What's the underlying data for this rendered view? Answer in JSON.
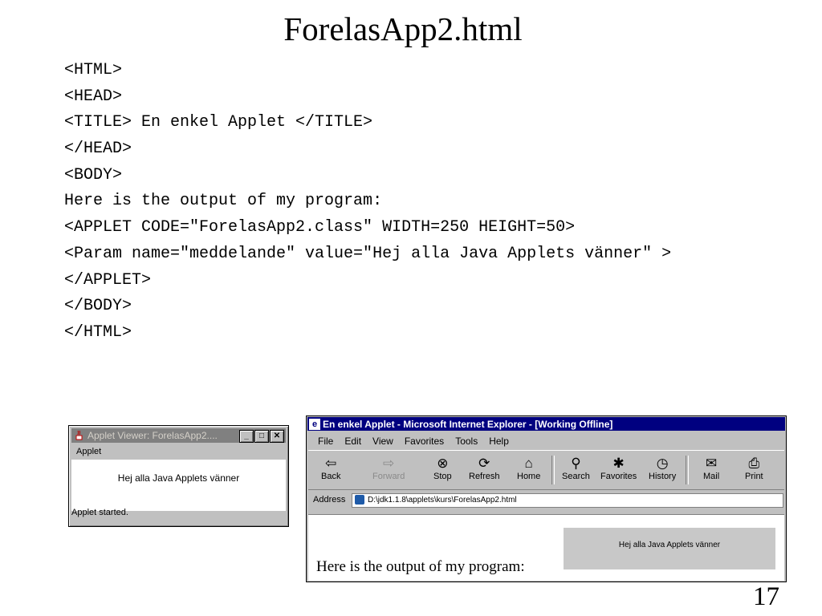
{
  "slide": {
    "title": "ForelasApp2.html",
    "page_number": "17"
  },
  "code_lines": [
    "<HTML>",
    "<HEAD>",
    "<TITLE> En enkel Applet </TITLE>",
    "</HEAD>",
    "<BODY>",
    "Here is the output of my program:",
    "<APPLET CODE=\"ForelasApp2.class\" WIDTH=250 HEIGHT=50>",
    "<Param name=\"meddelande\" value=\"Hej alla Java Applets vänner\" >",
    "</APPLET>",
    "</BODY>",
    "</HTML>"
  ],
  "applet_viewer": {
    "title": "Applet Viewer: ForelasApp2....",
    "menu": "Applet",
    "message": "Hej alla Java Applets vänner",
    "status": "Applet started."
  },
  "ie": {
    "title": "En enkel Applet - Microsoft Internet Explorer - [Working Offline]",
    "menu": [
      "File",
      "Edit",
      "View",
      "Favorites",
      "Tools",
      "Help"
    ],
    "toolbar": [
      "Back",
      "Forward",
      "Stop",
      "Refresh",
      "Home",
      "Search",
      "Favorites",
      "History",
      "Mail",
      "Print"
    ],
    "address_label": "Address",
    "address": "D:\\jdk1.1.8\\applets\\kurs\\ForelasApp2.html",
    "applet_message": "Hej alla Java Applets vänner",
    "page_text": "Here is the output of my program:"
  },
  "icons": {
    "minimize": "minimize-icon",
    "maximize": "maximize-icon",
    "close": "close-icon"
  }
}
